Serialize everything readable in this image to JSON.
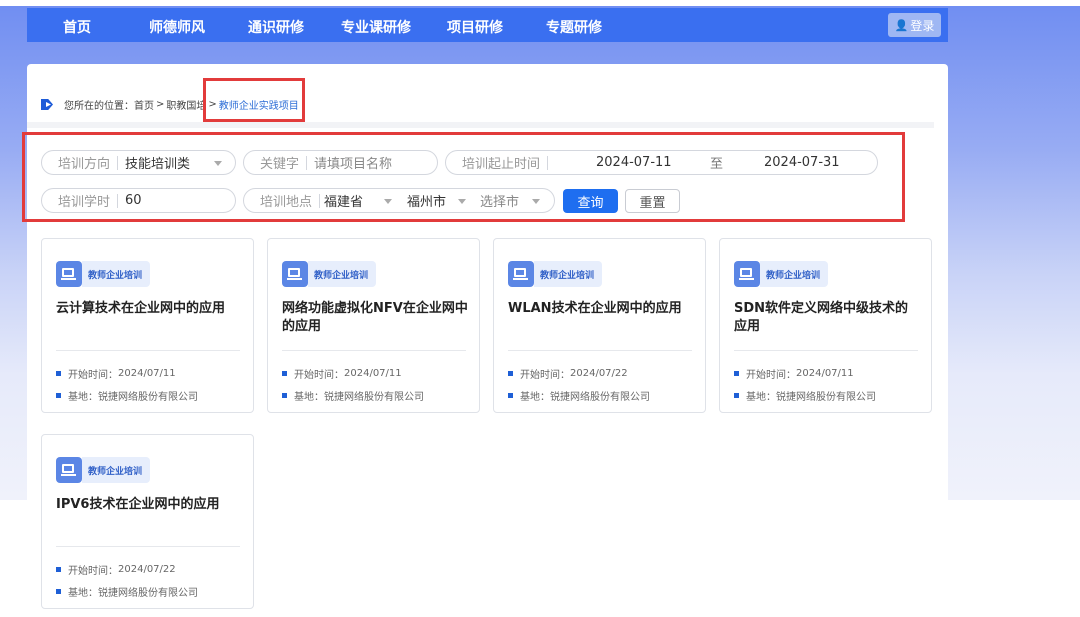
{
  "nav": {
    "items": [
      "首页",
      "师德师风",
      "通识研修",
      "专业课研修",
      "项目研修",
      "专题研修"
    ],
    "login_label": "登录"
  },
  "breadcrumb": {
    "prefix": "您所在的位置：",
    "items": [
      "首页",
      "职教国培",
      "教师企业实践项目"
    ],
    "separator": ">"
  },
  "filters": {
    "direction": {
      "label": "培训方向",
      "value": "技能培训类"
    },
    "keyword": {
      "label": "关键字",
      "placeholder": "请填项目名称"
    },
    "date_range": {
      "label": "培训起止时间",
      "start": "2024-07-11",
      "to": "至",
      "end": "2024-07-31"
    },
    "hours": {
      "label": "培训学时",
      "value": "60"
    },
    "location": {
      "label": "培训地点",
      "province": "福建省",
      "city": "福州市",
      "district_placeholder": "选择市"
    },
    "query_label": "查询",
    "reset_label": "重置"
  },
  "cards": [
    {
      "tag": "教师企业培训",
      "title": "云计算技术在企业网中的应用",
      "start_label": "开始时间：",
      "start": "2024/07/11",
      "base_label": "基地：",
      "base": "锐捷网络股份有限公司"
    },
    {
      "tag": "教师企业培训",
      "title": "网络功能虚拟化NFV在企业网中的应用",
      "start_label": "开始时间：",
      "start": "2024/07/11",
      "base_label": "基地：",
      "base": "锐捷网络股份有限公司"
    },
    {
      "tag": "教师企业培训",
      "title": "WLAN技术在企业网中的应用",
      "start_label": "开始时间：",
      "start": "2024/07/22",
      "base_label": "基地：",
      "base": "锐捷网络股份有限公司"
    },
    {
      "tag": "教师企业培训",
      "title": "SDN软件定义网络中级技术的应用",
      "start_label": "开始时间：",
      "start": "2024/07/11",
      "base_label": "基地：",
      "base": "锐捷网络股份有限公司"
    },
    {
      "tag": "教师企业培训",
      "title": "IPV6技术在企业网中的应用",
      "start_label": "开始时间：",
      "start": "2024/07/22",
      "base_label": "基地：",
      "base": "锐捷网络股份有限公司"
    }
  ],
  "colors": {
    "nav_bg": "#3a6ff0",
    "accent": "#1e6ef0",
    "highlight_box": "#e23b3b"
  }
}
